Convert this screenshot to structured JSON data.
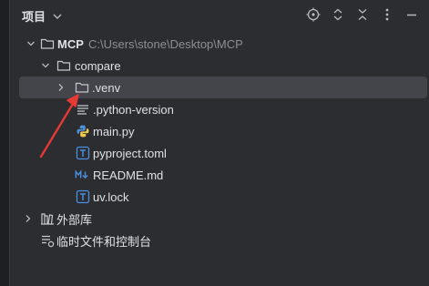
{
  "panel": {
    "title": "项目",
    "toolbar": {
      "icons": [
        "locate-icon",
        "expand-collapse-icon",
        "collapse-all-icon",
        "more-options-icon",
        "hide-icon"
      ]
    }
  },
  "tree": {
    "root": {
      "name": "MCP",
      "path": "C:\\Users\\stone\\Desktop\\MCP",
      "icon": "folder-icon",
      "expanded": true
    },
    "compare": {
      "name": "compare",
      "icon": "folder-icon",
      "expanded": true
    },
    "venv": {
      "name": ".venv",
      "icon": "folder-icon",
      "expanded": false,
      "selected": true
    },
    "files": [
      {
        "name": ".python-version",
        "icon": "text-file-icon"
      },
      {
        "name": "main.py",
        "icon": "python-file-icon"
      },
      {
        "name": "pyproject.toml",
        "icon": "toml-file-icon"
      },
      {
        "name": "README.md",
        "icon": "markdown-file-icon"
      },
      {
        "name": "uv.lock",
        "icon": "lock-file-icon"
      }
    ],
    "external_libraries": {
      "name": "外部库",
      "icon": "library-icon",
      "expanded": false
    },
    "scratches": {
      "name": "临时文件和控制台",
      "icon": "scratches-icon"
    }
  },
  "colors": {
    "background": "#2b2d30",
    "selected_row": "#43454a",
    "annotation_arrow": "#e53935",
    "python_blue": "#4f8fd6",
    "file_accent": "#4a8fe0"
  }
}
